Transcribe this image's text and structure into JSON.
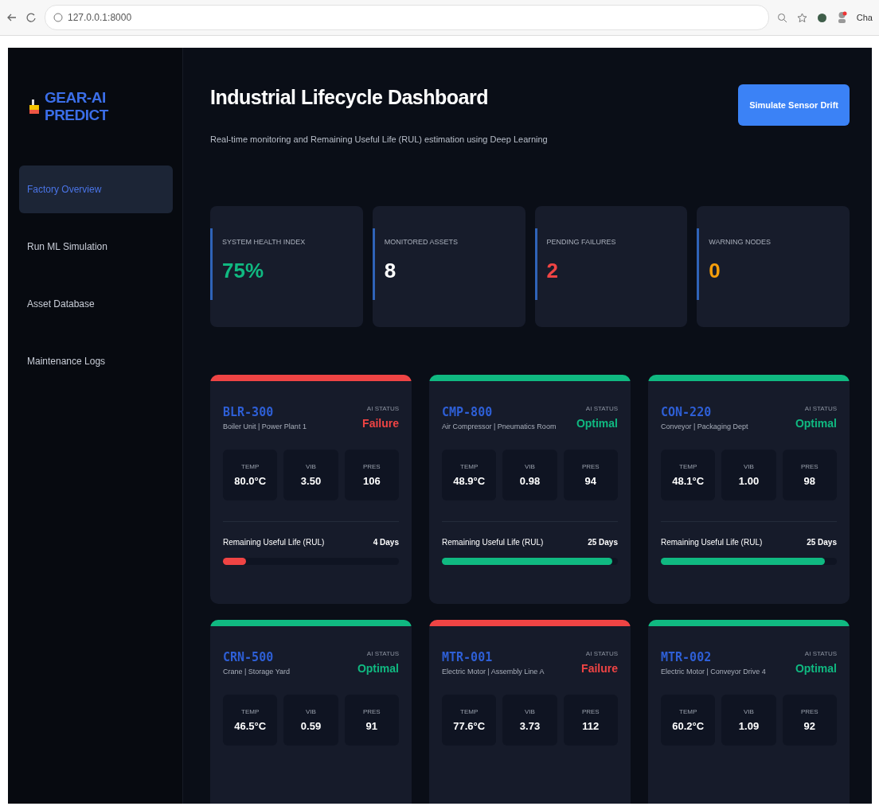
{
  "browser": {
    "url": "127.0.0.1:8000",
    "profile_label": "Cha"
  },
  "sidebar": {
    "logo": "GEAR-AI PREDICT",
    "items": [
      {
        "label": "Factory Overview",
        "selected": true
      },
      {
        "label": "Run ML Simulation",
        "selected": false
      },
      {
        "label": "Asset Database",
        "selected": false
      },
      {
        "label": "Maintenance Logs",
        "selected": false
      }
    ]
  },
  "header": {
    "title": "Industrial Lifecycle Dashboard",
    "subtitle": "Real-time monitoring and Remaining Useful Life (RUL) estimation using Deep Learning",
    "button": "Simulate Sensor Drift"
  },
  "stats": [
    {
      "label": "SYSTEM HEALTH INDEX",
      "value": "75%",
      "color": "#10b981"
    },
    {
      "label": "MONITORED ASSETS",
      "value": "8",
      "color": "#ffffff"
    },
    {
      "label": "PENDING FAILURES",
      "value": "2",
      "color": "#ef4444"
    },
    {
      "label": "WARNING NODES",
      "value": "0",
      "color": "#f59e0b"
    }
  ],
  "assets": [
    {
      "id": "BLR-300",
      "location": "Boiler Unit | Power Plant 1",
      "status_label": "AI STATUS",
      "status": "Failure",
      "color": "#ef4444",
      "metrics": [
        {
          "label": "TEMP",
          "value": "80.0°C"
        },
        {
          "label": "VIB",
          "value": "3.50"
        },
        {
          "label": "PRES",
          "value": "106"
        }
      ],
      "rul_label": "Remaining Useful Life (RUL)",
      "rul": "4 Days",
      "level": 0.13
    },
    {
      "id": "CMP-800",
      "location": "Air Compressor | Pneumatics Room",
      "status_label": "AI STATUS",
      "status": "Optimal",
      "color": "#10b981",
      "metrics": [
        {
          "label": "TEMP",
          "value": "48.9°C"
        },
        {
          "label": "VIB",
          "value": "0.98"
        },
        {
          "label": "PRES",
          "value": "94"
        }
      ],
      "rul_label": "Remaining Useful Life (RUL)",
      "rul": "25 Days",
      "level": 0.97
    },
    {
      "id": "CON-220",
      "location": "Conveyor | Packaging Dept",
      "status_label": "AI STATUS",
      "status": "Optimal",
      "color": "#10b981",
      "metrics": [
        {
          "label": "TEMP",
          "value": "48.1°C"
        },
        {
          "label": "VIB",
          "value": "1.00"
        },
        {
          "label": "PRES",
          "value": "98"
        }
      ],
      "rul_label": "Remaining Useful Life (RUL)",
      "rul": "25 Days",
      "level": 0.93
    },
    {
      "id": "CRN-500",
      "location": "Crane | Storage Yard",
      "status_label": "AI STATUS",
      "status": "Optimal",
      "color": "#10b981",
      "metrics": [
        {
          "label": "TEMP",
          "value": "46.5°C"
        },
        {
          "label": "VIB",
          "value": "0.59"
        },
        {
          "label": "PRES",
          "value": "91"
        }
      ]
    },
    {
      "id": "MTR-001",
      "location": "Electric Motor | Assembly Line A",
      "status_label": "AI STATUS",
      "status": "Failure",
      "color": "#ef4444",
      "metrics": [
        {
          "label": "TEMP",
          "value": "77.6°C"
        },
        {
          "label": "VIB",
          "value": "3.73"
        },
        {
          "label": "PRES",
          "value": "112"
        }
      ]
    },
    {
      "id": "MTR-002",
      "location": "Electric Motor | Conveyor Drive 4",
      "status_label": "AI STATUS",
      "status": "Optimal",
      "color": "#10b981",
      "metrics": [
        {
          "label": "TEMP",
          "value": "60.2°C"
        },
        {
          "label": "VIB",
          "value": "1.09"
        },
        {
          "label": "PRES",
          "value": "92"
        }
      ]
    }
  ]
}
